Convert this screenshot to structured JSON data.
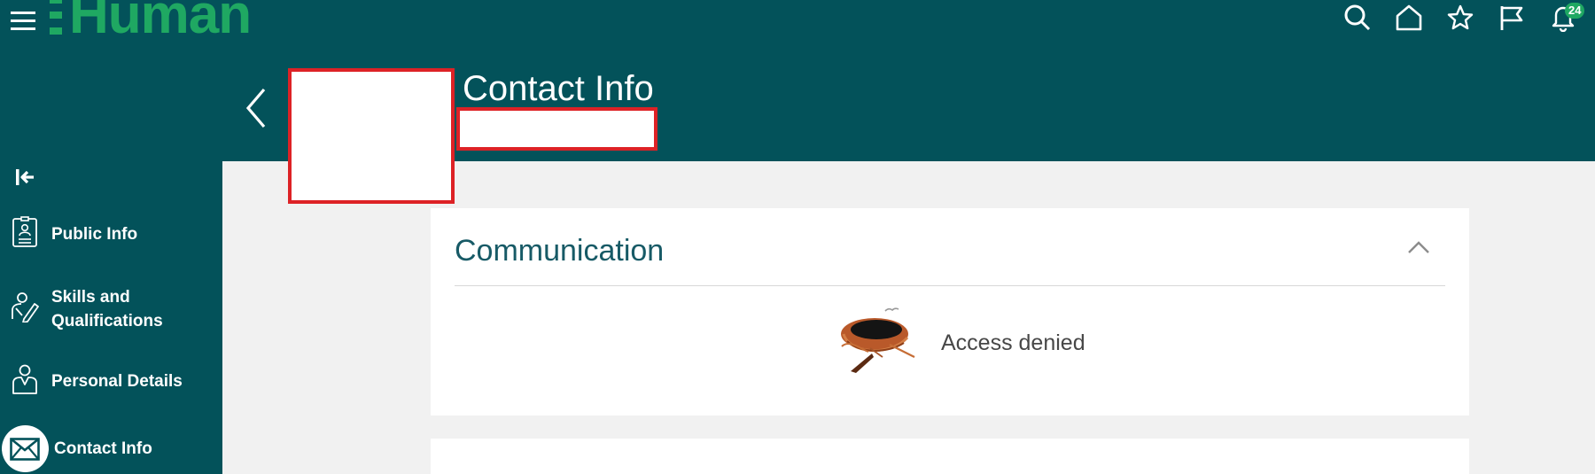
{
  "header": {
    "logo_text": "Human",
    "notifications_count": "24",
    "icons": [
      "hamburger-icon",
      "search-icon",
      "home-icon",
      "star-icon",
      "flag-icon",
      "bell-icon"
    ]
  },
  "page": {
    "title": "Contact Info"
  },
  "sidebar": {
    "items": [
      {
        "label": "Public Info",
        "icon": "id-badge-icon"
      },
      {
        "label": "Skills and Qualifications",
        "label_line1": "Skills and",
        "label_line2": "Qualifications",
        "icon": "person-pencil-icon"
      },
      {
        "label": "Personal Details",
        "icon": "person-icon"
      },
      {
        "label": "Contact Info",
        "icon": "envelope-icon",
        "active": true
      }
    ]
  },
  "main": {
    "communication": {
      "title": "Communication",
      "message": "Access denied"
    }
  },
  "colors": {
    "header_bg": "#03525a",
    "brand_green": "#1fa862",
    "redaction_border": "#dd2226",
    "card_title": "#175a66"
  }
}
